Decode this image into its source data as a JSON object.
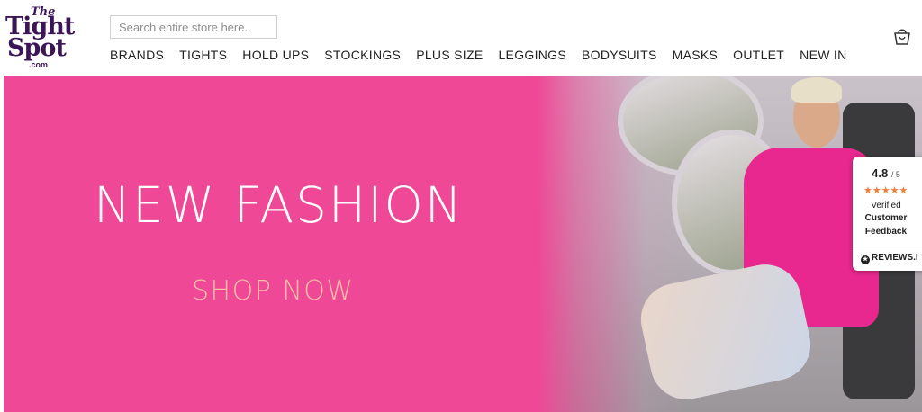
{
  "logo": {
    "line1": "The",
    "line2": "Tight",
    "line3": "Spot",
    "line4": ".com"
  },
  "search": {
    "placeholder": "Search entire store here.."
  },
  "nav": [
    "BRANDS",
    "TIGHTS",
    "HOLD UPS",
    "STOCKINGS",
    "PLUS SIZE",
    "LEGGINGS",
    "BODYSUITS",
    "MASKS",
    "OUTLET",
    "NEW IN"
  ],
  "hero": {
    "title": "NEW FASHION",
    "cta": "SHOP NOW",
    "bg_color": "#ee4896",
    "cta_color": "#f6c0a6"
  },
  "reviews": {
    "score": "4.8",
    "out_of": "/ 5",
    "stars": "★★★★★",
    "line1": "Verified",
    "line2": "Customer",
    "line3": "Feedback",
    "link": "REVIEWS.I",
    "star_color": "#f07c39"
  },
  "icons": {
    "cart": "shopping-bag-icon"
  }
}
